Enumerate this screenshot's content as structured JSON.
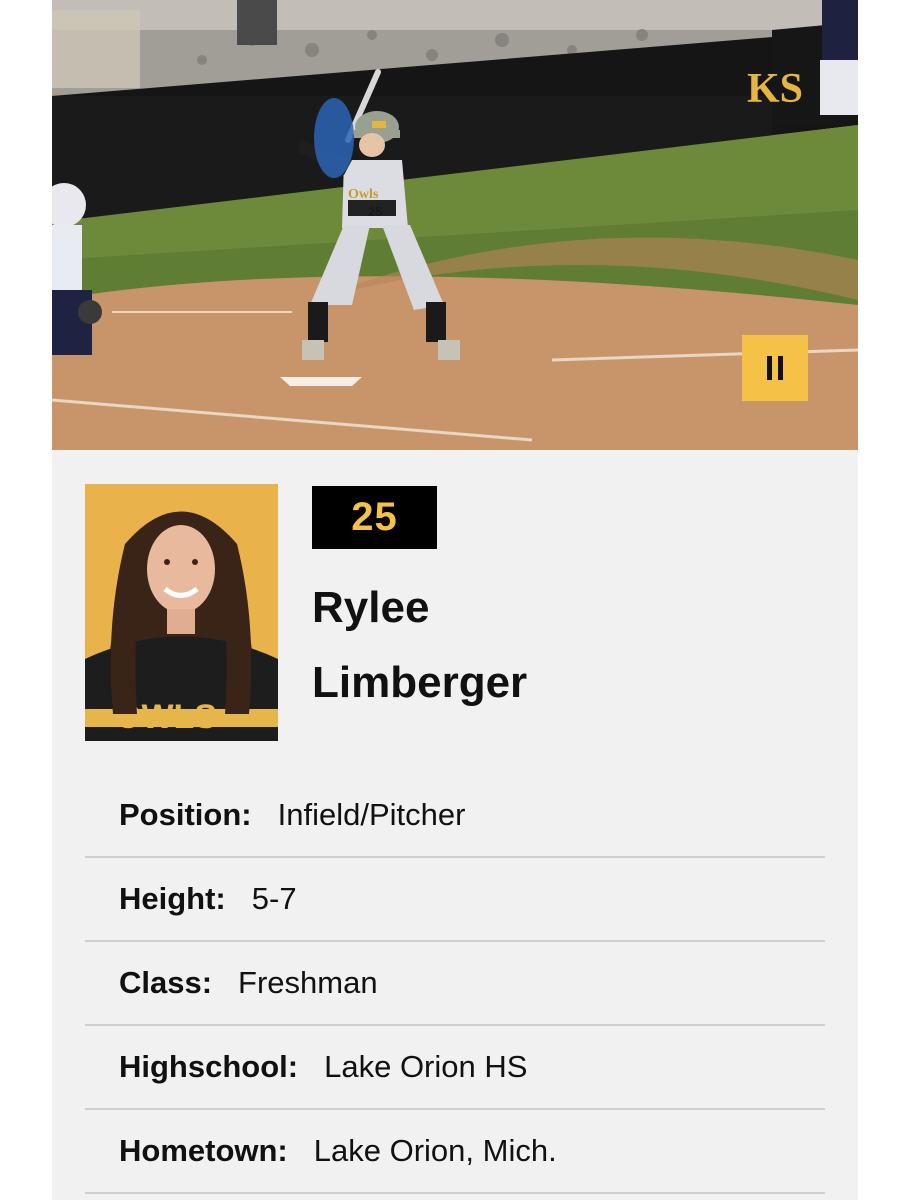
{
  "player": {
    "number": "25",
    "first_name": "Rylee",
    "last_name": "Limberger",
    "headshot_text": "OWLS"
  },
  "hero": {
    "pause_icon": "pause-icon",
    "logo_text": "KS"
  },
  "details": [
    {
      "label": "Position:",
      "value": "Infield/Pitcher"
    },
    {
      "label": "Height:",
      "value": "5-7"
    },
    {
      "label": "Class:",
      "value": "Freshman"
    },
    {
      "label": "Highschool:",
      "value": "Lake Orion HS"
    },
    {
      "label": "Hometown:",
      "value": "Lake Orion, Mich."
    }
  ],
  "colors": {
    "accent_gold": "#f5c146",
    "black": "#000000",
    "card_bg": "#f1f1f1",
    "divider": "#cfcfcf"
  }
}
